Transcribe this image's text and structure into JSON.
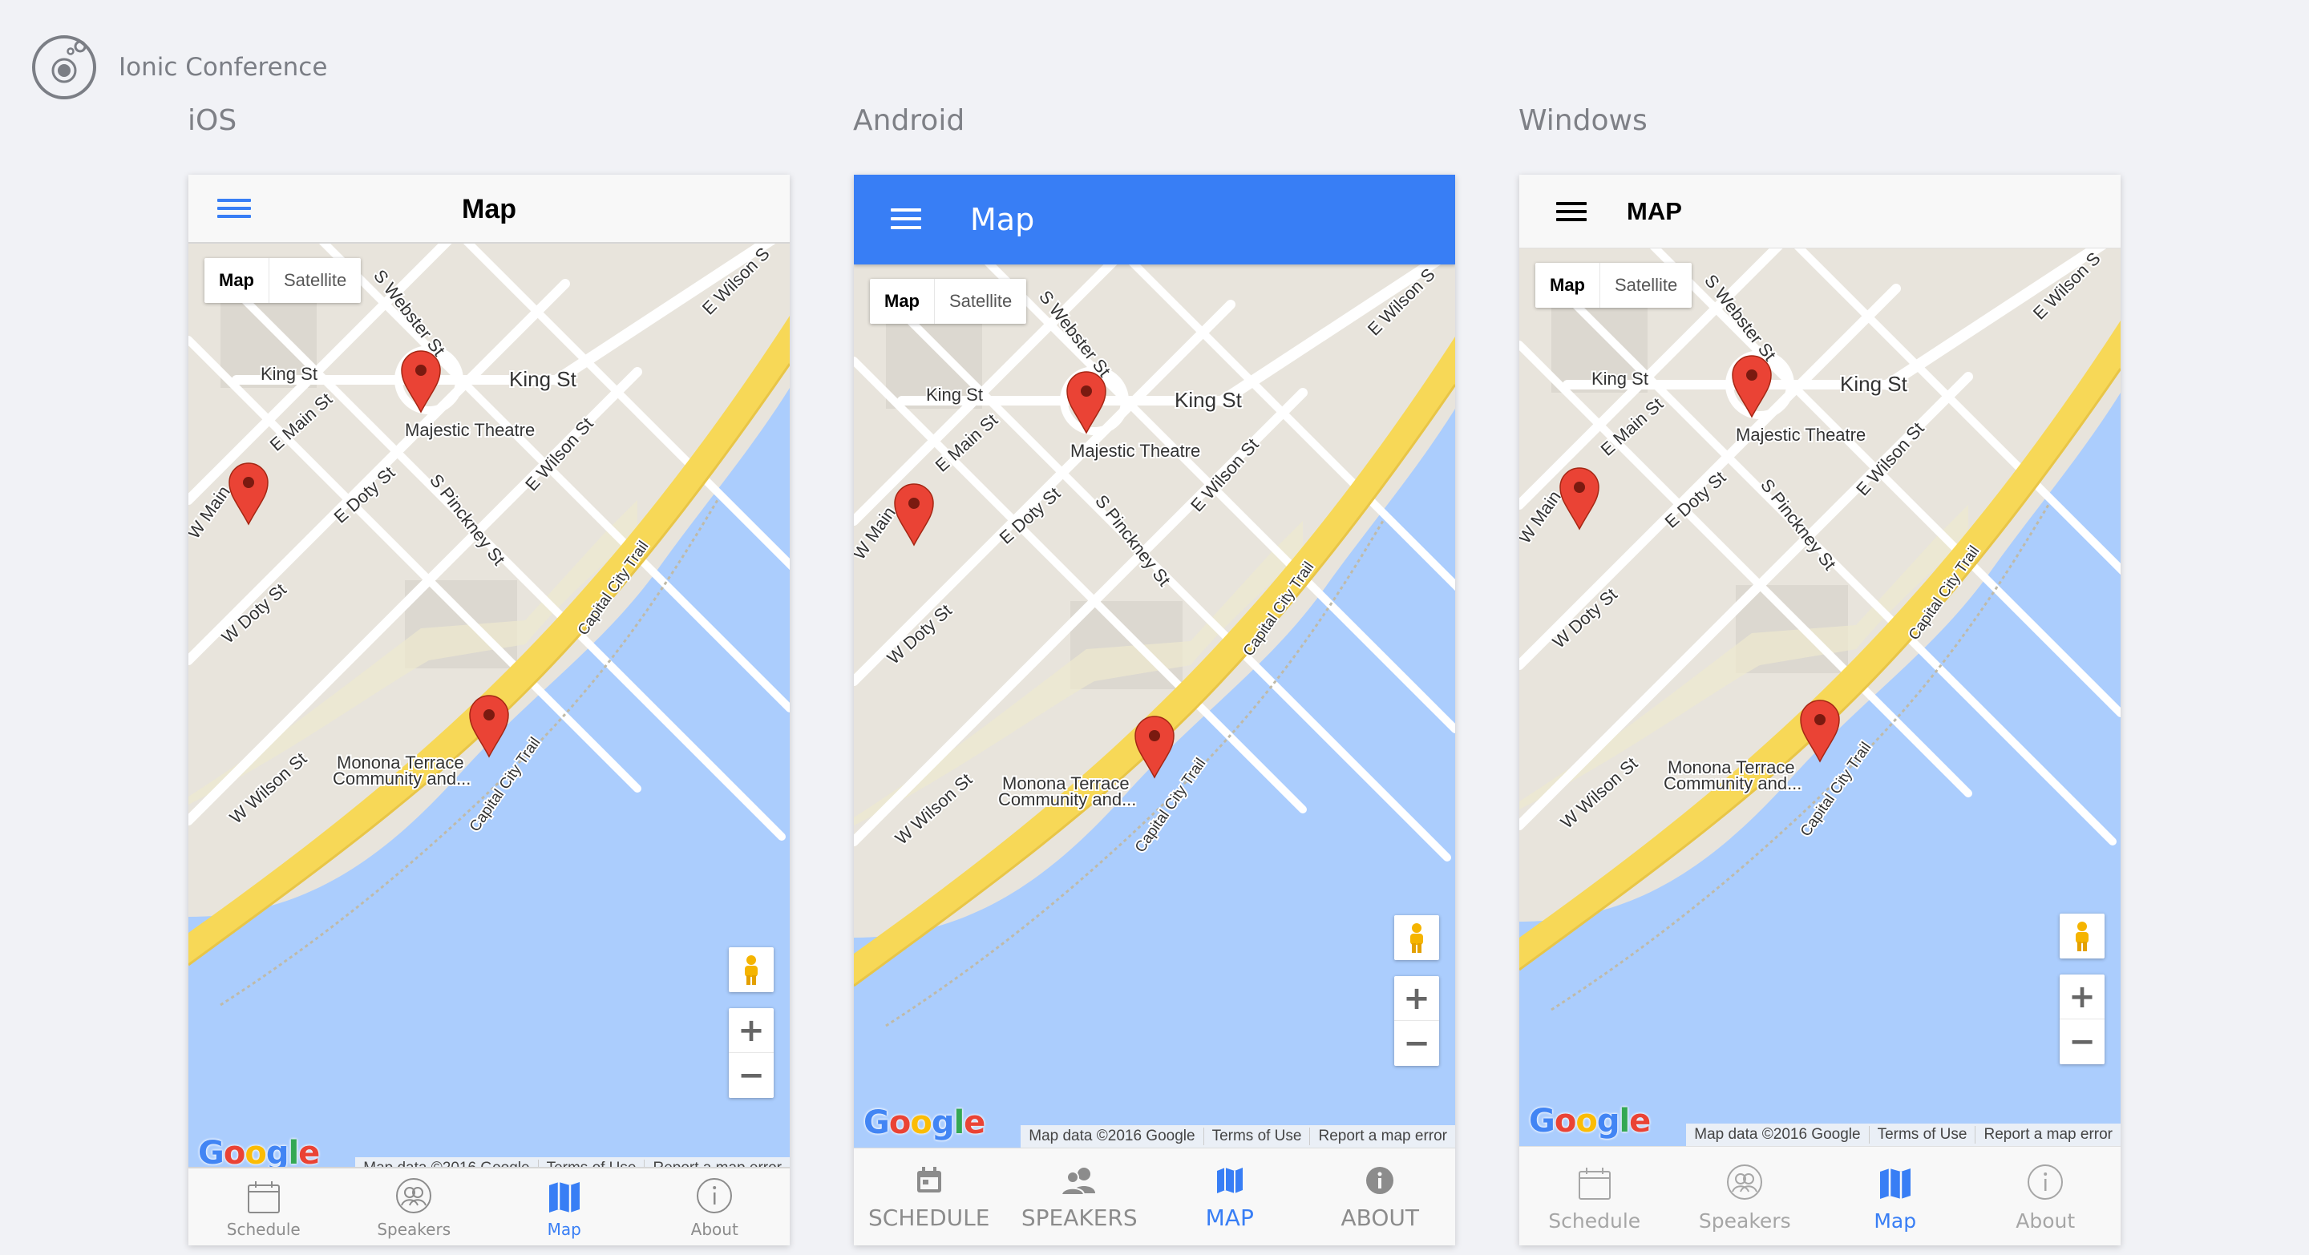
{
  "app": {
    "title": "Ionic Conference"
  },
  "platforms": [
    {
      "label": "iOS",
      "page_title": "Map"
    },
    {
      "label": "Android",
      "page_title": "Map"
    },
    {
      "label": "Windows",
      "page_title": "MAP"
    }
  ],
  "map": {
    "map_type_map": "Map",
    "map_type_satellite": "Satellite",
    "google": "Google",
    "attribution": [
      "Map data ©2016 Google",
      "Terms of Use",
      "Report a map error"
    ],
    "zoom_in": "+",
    "zoom_out": "−",
    "labels": {
      "webster": "S Webster St",
      "wilson_e_top": "E Wilson S",
      "king_left": "King St",
      "king_right": "King St",
      "majestic": "Majestic Theatre",
      "main": "E Main St",
      "wmain": "W Main",
      "wilson_e": "E Wilson St",
      "edoty": "E Doty St",
      "pinckney": "S Pinckney St",
      "wdoty": "W Doty St",
      "capital1": "Capital City Trail",
      "monona1": "Monona Terrace",
      "monona2": "Community and...",
      "capital2": "Capital City Trail",
      "wwilson": "W Wilson St"
    }
  },
  "tabs": {
    "ios": [
      "Schedule",
      "Speakers",
      "Map",
      "About"
    ],
    "android": [
      "SCHEDULE",
      "SPEAKERS",
      "MAP",
      "ABOUT"
    ],
    "windows": [
      "Schedule",
      "Speakers",
      "Map",
      "About"
    ]
  },
  "colors": {
    "ios_accent": "#387ef5",
    "android_toolbar": "#387ef5",
    "tab_inactive": "#8c8c8c",
    "map_land": "#e8e4dc",
    "map_water": "#abcdfd",
    "map_highway": "#f7d857",
    "map_road": "#ffffff",
    "marker": "#ea4335"
  }
}
